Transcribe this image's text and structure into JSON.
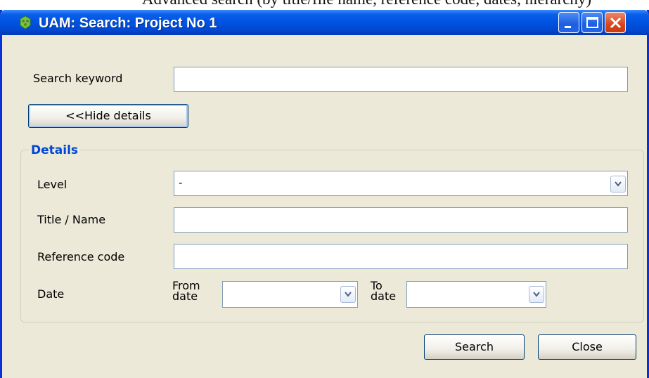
{
  "document": {
    "heading": "Advanced search (by title/file name, reference code, dates, hierarchy)"
  },
  "window": {
    "title": "UAM: Search: Project No 1",
    "controls": {
      "minimize": "minimize-icon",
      "maximize": "maximize-icon",
      "close": "close-icon"
    }
  },
  "form": {
    "search_keyword": {
      "label": "Search keyword",
      "value": ""
    },
    "toggle_details_label": "<<Hide details",
    "details": {
      "legend": "Details",
      "level": {
        "label": "Level",
        "value": "-"
      },
      "title_name": {
        "label": "Title / Name",
        "value": ""
      },
      "reference_code": {
        "label": "Reference code",
        "value": ""
      },
      "date": {
        "label": "Date",
        "from_label_line1": "From",
        "from_label_line2": "date",
        "from_value": "",
        "to_label_line1": "To",
        "to_label_line2": "date",
        "to_value": ""
      }
    },
    "buttons": {
      "search": "Search",
      "close": "Close"
    }
  },
  "colors": {
    "titlebar": "#0054e3",
    "window_bg": "#ece9d8",
    "legend": "#0046d5",
    "close_button": "#d9461c"
  }
}
